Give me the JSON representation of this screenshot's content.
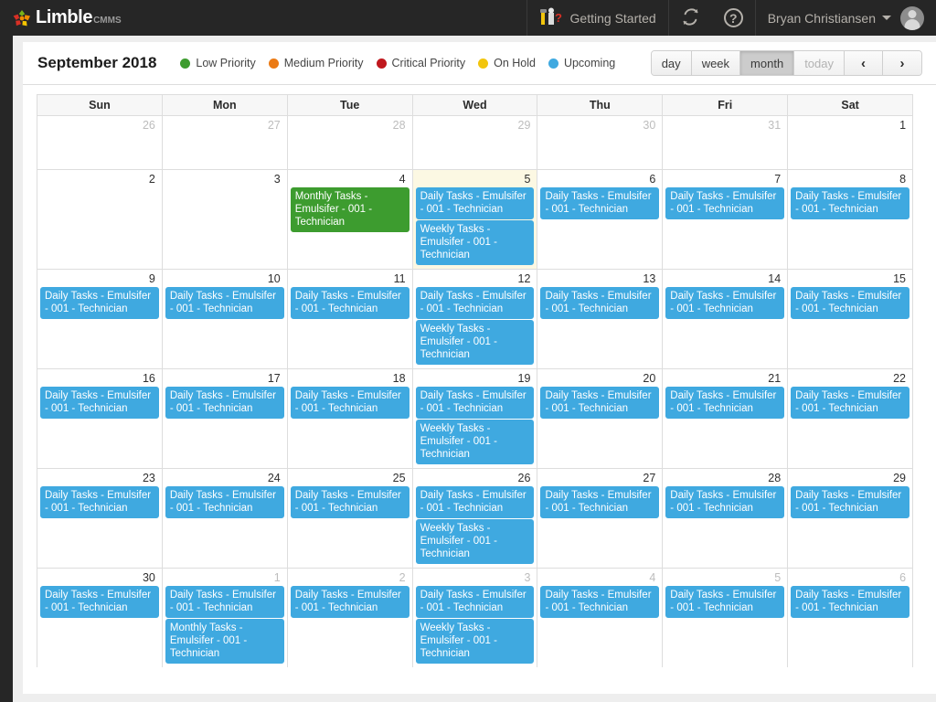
{
  "app": {
    "brand": "Limble",
    "brand_suffix": "CMMS",
    "logo_colors": [
      "#7ab317",
      "#d93025",
      "#f08c00",
      "#f5c400"
    ]
  },
  "topbar": {
    "getting_started_label": "Getting Started",
    "getting_started_icon": "hammer-question-icon",
    "refresh_icon": "refresh-icon",
    "help_icon": "help-circle-icon",
    "help_glyph": "?",
    "user_name": "Bryan Christiansen",
    "user_caret_icon": "chevron-down-icon",
    "avatar_icon": "avatar-icon"
  },
  "toolbar": {
    "title": "September 2018",
    "legend": [
      {
        "label": "Low Priority",
        "color": "#3d9c2f",
        "key": "low"
      },
      {
        "label": "Medium Priority",
        "color": "#eb7a14",
        "key": "medium"
      },
      {
        "label": "Critical Priority",
        "color": "#c0181e",
        "key": "critical"
      },
      {
        "label": "On Hold",
        "color": "#f2c50d",
        "key": "onhold"
      },
      {
        "label": "Upcoming",
        "color": "#3fa9e0",
        "key": "upcoming"
      }
    ],
    "views": [
      {
        "label": "day",
        "state": "normal"
      },
      {
        "label": "week",
        "state": "normal"
      },
      {
        "label": "month",
        "state": "active"
      },
      {
        "label": "today",
        "state": "disabled"
      }
    ],
    "nav": [
      {
        "label": "‹",
        "name": "prev-month-button"
      },
      {
        "label": "›",
        "name": "next-month-button"
      }
    ]
  },
  "calendar": {
    "day_headers": [
      "Sun",
      "Mon",
      "Tue",
      "Wed",
      "Thu",
      "Fri",
      "Sat"
    ],
    "weeks": [
      {
        "compact": true,
        "days": [
          {
            "num": "26",
            "other": true,
            "today": false,
            "events": []
          },
          {
            "num": "27",
            "other": true,
            "today": false,
            "events": []
          },
          {
            "num": "28",
            "other": true,
            "today": false,
            "events": []
          },
          {
            "num": "29",
            "other": true,
            "today": false,
            "events": []
          },
          {
            "num": "30",
            "other": true,
            "today": false,
            "events": []
          },
          {
            "num": "31",
            "other": true,
            "today": false,
            "events": []
          },
          {
            "num": "1",
            "other": false,
            "today": false,
            "events": []
          }
        ]
      },
      {
        "compact": false,
        "days": [
          {
            "num": "2",
            "other": false,
            "today": false,
            "events": []
          },
          {
            "num": "3",
            "other": false,
            "today": false,
            "events": []
          },
          {
            "num": "4",
            "other": false,
            "today": false,
            "events": [
              {
                "title": "Monthly Tasks - Emulsifer - 001 - Technician",
                "color": "green"
              }
            ]
          },
          {
            "num": "5",
            "other": false,
            "today": true,
            "events": [
              {
                "title": "Daily Tasks - Emulsifer - 001 - Technician",
                "color": "blue"
              },
              {
                "title": "Weekly Tasks - Emulsifer - 001 - Technician",
                "color": "blue"
              }
            ]
          },
          {
            "num": "6",
            "other": false,
            "today": false,
            "events": [
              {
                "title": "Daily Tasks - Emulsifer - 001 - Technician",
                "color": "blue"
              }
            ]
          },
          {
            "num": "7",
            "other": false,
            "today": false,
            "events": [
              {
                "title": "Daily Tasks - Emulsifer - 001 - Technician",
                "color": "blue"
              }
            ]
          },
          {
            "num": "8",
            "other": false,
            "today": false,
            "events": [
              {
                "title": "Daily Tasks - Emulsifer - 001 - Technician",
                "color": "blue"
              }
            ]
          }
        ]
      },
      {
        "compact": false,
        "days": [
          {
            "num": "9",
            "other": false,
            "today": false,
            "events": [
              {
                "title": "Daily Tasks - Emulsifer - 001 - Technician",
                "color": "blue"
              }
            ]
          },
          {
            "num": "10",
            "other": false,
            "today": false,
            "events": [
              {
                "title": "Daily Tasks - Emulsifer - 001 - Technician",
                "color": "blue"
              }
            ]
          },
          {
            "num": "11",
            "other": false,
            "today": false,
            "events": [
              {
                "title": "Daily Tasks - Emulsifer - 001 - Technician",
                "color": "blue"
              }
            ]
          },
          {
            "num": "12",
            "other": false,
            "today": false,
            "events": [
              {
                "title": "Daily Tasks - Emulsifer - 001 - Technician",
                "color": "blue"
              },
              {
                "title": "Weekly Tasks - Emulsifer - 001 - Technician",
                "color": "blue"
              }
            ]
          },
          {
            "num": "13",
            "other": false,
            "today": false,
            "events": [
              {
                "title": "Daily Tasks - Emulsifer - 001 - Technician",
                "color": "blue"
              }
            ]
          },
          {
            "num": "14",
            "other": false,
            "today": false,
            "events": [
              {
                "title": "Daily Tasks - Emulsifer - 001 - Technician",
                "color": "blue"
              }
            ]
          },
          {
            "num": "15",
            "other": false,
            "today": false,
            "events": [
              {
                "title": "Daily Tasks - Emulsifer - 001 - Technician",
                "color": "blue"
              }
            ]
          }
        ]
      },
      {
        "compact": false,
        "days": [
          {
            "num": "16",
            "other": false,
            "today": false,
            "events": [
              {
                "title": "Daily Tasks - Emulsifer - 001 - Technician",
                "color": "blue"
              }
            ]
          },
          {
            "num": "17",
            "other": false,
            "today": false,
            "events": [
              {
                "title": "Daily Tasks - Emulsifer - 001 - Technician",
                "color": "blue"
              }
            ]
          },
          {
            "num": "18",
            "other": false,
            "today": false,
            "events": [
              {
                "title": "Daily Tasks - Emulsifer - 001 - Technician",
                "color": "blue"
              }
            ]
          },
          {
            "num": "19",
            "other": false,
            "today": false,
            "events": [
              {
                "title": "Daily Tasks - Emulsifer - 001 - Technician",
                "color": "blue"
              },
              {
                "title": "Weekly Tasks - Emulsifer - 001 - Technician",
                "color": "blue"
              }
            ]
          },
          {
            "num": "20",
            "other": false,
            "today": false,
            "events": [
              {
                "title": "Daily Tasks - Emulsifer - 001 - Technician",
                "color": "blue"
              }
            ]
          },
          {
            "num": "21",
            "other": false,
            "today": false,
            "events": [
              {
                "title": "Daily Tasks - Emulsifer - 001 - Technician",
                "color": "blue"
              }
            ]
          },
          {
            "num": "22",
            "other": false,
            "today": false,
            "events": [
              {
                "title": "Daily Tasks - Emulsifer - 001 - Technician",
                "color": "blue"
              }
            ]
          }
        ]
      },
      {
        "compact": false,
        "days": [
          {
            "num": "23",
            "other": false,
            "today": false,
            "events": [
              {
                "title": "Daily Tasks - Emulsifer - 001 - Technician",
                "color": "blue"
              }
            ]
          },
          {
            "num": "24",
            "other": false,
            "today": false,
            "events": [
              {
                "title": "Daily Tasks - Emulsifer - 001 - Technician",
                "color": "blue"
              }
            ]
          },
          {
            "num": "25",
            "other": false,
            "today": false,
            "events": [
              {
                "title": "Daily Tasks - Emulsifer - 001 - Technician",
                "color": "blue"
              }
            ]
          },
          {
            "num": "26",
            "other": false,
            "today": false,
            "events": [
              {
                "title": "Daily Tasks - Emulsifer - 001 - Technician",
                "color": "blue"
              },
              {
                "title": "Weekly Tasks - Emulsifer - 001 - Technician",
                "color": "blue"
              }
            ]
          },
          {
            "num": "27",
            "other": false,
            "today": false,
            "events": [
              {
                "title": "Daily Tasks - Emulsifer - 001 - Technician",
                "color": "blue"
              }
            ]
          },
          {
            "num": "28",
            "other": false,
            "today": false,
            "events": [
              {
                "title": "Daily Tasks - Emulsifer - 001 - Technician",
                "color": "blue"
              }
            ]
          },
          {
            "num": "29",
            "other": false,
            "today": false,
            "events": [
              {
                "title": "Daily Tasks - Emulsifer - 001 - Technician",
                "color": "blue"
              }
            ]
          }
        ]
      },
      {
        "compact": false,
        "days": [
          {
            "num": "30",
            "other": false,
            "today": false,
            "events": [
              {
                "title": "Daily Tasks - Emulsifer - 001 - Technician",
                "color": "blue"
              }
            ]
          },
          {
            "num": "1",
            "other": true,
            "today": false,
            "events": [
              {
                "title": "Daily Tasks - Emulsifer - 001 - Technician",
                "color": "blue"
              },
              {
                "title": "Monthly Tasks - Emulsifer - 001 - Technician",
                "color": "blue"
              }
            ]
          },
          {
            "num": "2",
            "other": true,
            "today": false,
            "events": [
              {
                "title": "Daily Tasks - Emulsifer - 001 - Technician",
                "color": "blue"
              }
            ]
          },
          {
            "num": "3",
            "other": true,
            "today": false,
            "events": [
              {
                "title": "Daily Tasks - Emulsifer - 001 - Technician",
                "color": "blue"
              },
              {
                "title": "Weekly Tasks - Emulsifer - 001 - Technician",
                "color": "blue"
              }
            ]
          },
          {
            "num": "4",
            "other": true,
            "today": false,
            "events": [
              {
                "title": "Daily Tasks - Emulsifer - 001 - Technician",
                "color": "blue"
              }
            ]
          },
          {
            "num": "5",
            "other": true,
            "today": false,
            "events": [
              {
                "title": "Daily Tasks - Emulsifer - 001 - Technician",
                "color": "blue"
              }
            ]
          },
          {
            "num": "6",
            "other": true,
            "today": false,
            "events": [
              {
                "title": "Daily Tasks - Emulsifer - 001 - Technician",
                "color": "blue"
              }
            ]
          }
        ]
      }
    ]
  }
}
